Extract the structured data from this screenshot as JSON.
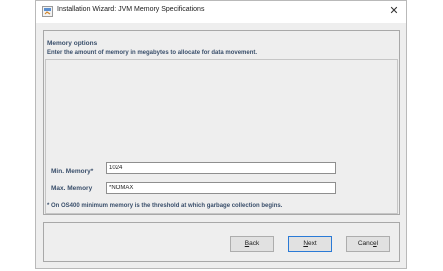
{
  "window": {
    "title": "Installation Wizard: JVM Memory Specifications",
    "close_glyph": "✕",
    "app_icon": "java-installer-icon"
  },
  "panel": {
    "heading": "Memory options",
    "description": "Enter the amount of memory in megabytes to allocate for data movement.",
    "min_memory": {
      "label": "Min. Memory*",
      "value": "1024"
    },
    "max_memory": {
      "label": "Max. Memory",
      "value": "*NOMAX"
    },
    "note": "* On OS400 minimum memory is the threshold at which garbage collection begins."
  },
  "buttons": {
    "back": {
      "mnemonic": "B",
      "rest": "ack"
    },
    "next": {
      "mnemonic": "N",
      "rest": "ext"
    },
    "cancel": {
      "pre": "Canc",
      "mnemonic": "e",
      "rest": "l"
    }
  },
  "colors": {
    "label_text": "#3a4f6b",
    "default_button_border": "#2a7ad6",
    "window_bg": "#eeeeee"
  }
}
